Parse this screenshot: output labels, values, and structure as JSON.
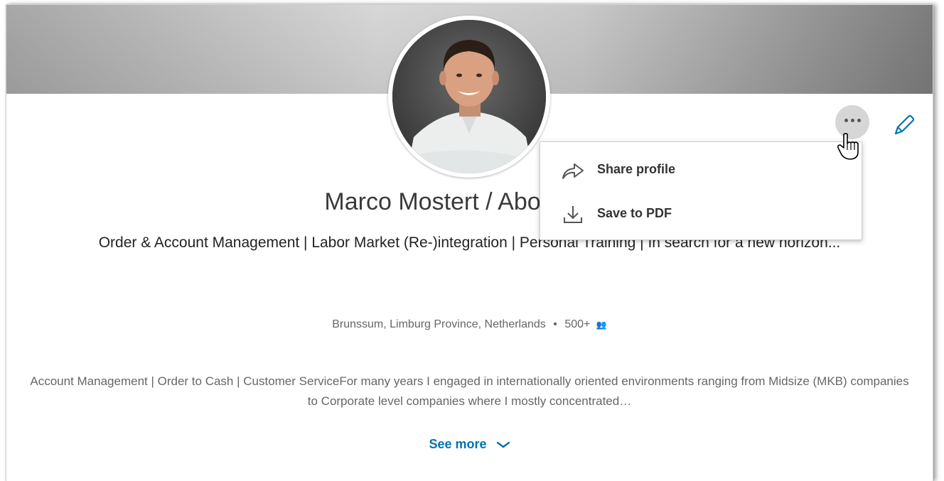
{
  "profile": {
    "name": "Marco Mostert / About to m",
    "headline": "Order & Account Management | Labor Market (Re-)integration | Personal Training | In search for a new horizon...",
    "location": "Brunssum, Limburg Province, Netherlands",
    "separator": "•",
    "connections": "500+",
    "connections_icon": "people-icon",
    "summary": "Account Management | Order to Cash | Customer ServiceFor many years I engaged in internationally oriented environments ranging from Midsize (MKB) companies to Corporate level companies where I mostly concentrated…",
    "see_more_label": "See more"
  },
  "actions": {
    "more_button_icon": "more-horizontal-icon",
    "edit_icon": "pencil-icon"
  },
  "dropdown": {
    "items": [
      {
        "label": "Share profile",
        "icon": "share-arrow-icon"
      },
      {
        "label": "Save to PDF",
        "icon": "download-icon"
      }
    ]
  },
  "colors": {
    "accent": "#0073b1",
    "text_primary": "#3a3a3a",
    "text_secondary": "#666666",
    "more_button_bg": "#d6d6d6"
  }
}
